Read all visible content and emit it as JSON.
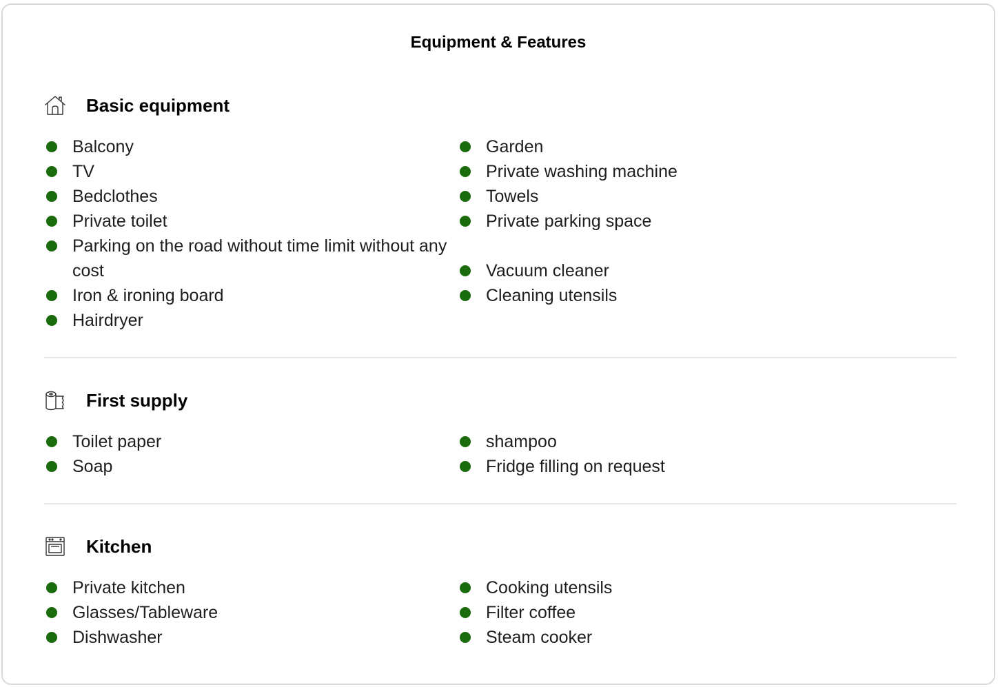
{
  "title": "Equipment & Features",
  "sections": [
    {
      "icon": "house-icon",
      "title": "Basic equipment",
      "left": [
        "Balcony",
        "TV",
        "Bedclothes",
        "Private toilet",
        "Parking on the road without time limit without any cost",
        "Iron & ironing board",
        "Hairdryer"
      ],
      "right": [
        "Garden",
        "Private washing machine",
        "Towels",
        "Private parking space",
        "",
        "Vacuum cleaner",
        "Cleaning utensils"
      ]
    },
    {
      "icon": "toilet-paper-icon",
      "title": "First supply",
      "left": [
        "Toilet paper",
        "Soap"
      ],
      "right": [
        "shampoo",
        "Fridge filling on request"
      ]
    },
    {
      "icon": "oven-icon",
      "title": "Kitchen",
      "left": [
        "Private kitchen",
        "Glasses/Tableware",
        "Dishwasher"
      ],
      "right": [
        "Cooking utensils",
        "Filter coffee",
        "Steam cooker"
      ]
    }
  ],
  "colors": {
    "bullet": "#1a6b0b",
    "border": "#d9d9d9",
    "divider": "#e6e6e6"
  }
}
